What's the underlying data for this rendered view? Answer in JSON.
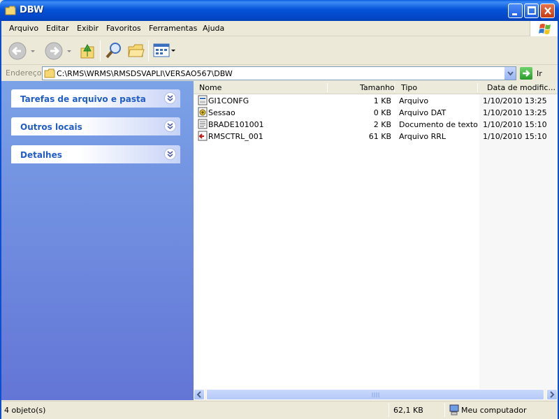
{
  "window": {
    "title": "DBW"
  },
  "menu": {
    "items": [
      {
        "first": "A",
        "rest": "rquivo"
      },
      {
        "first": "E",
        "rest": "ditar"
      },
      {
        "first": "E",
        "rest": "x",
        "tail": "ibir",
        "underline_index": 1
      },
      {
        "first": "F",
        "rest": "avoritos"
      },
      {
        "first": "F",
        "rest": "e",
        "tail": "rramentas",
        "underline_index": 1
      },
      {
        "first": "A",
        "rest": "j",
        "tail": "uda",
        "underline_index": 1
      }
    ],
    "labels": [
      "Arquivo",
      "Editar",
      "Exibir",
      "Favoritos",
      "Ferramentas",
      "Ajuda"
    ]
  },
  "address": {
    "label": "Endereço",
    "path": "C:\\RMS\\WRMS\\RMSDSVAPLI\\VERSAO567\\DBW",
    "go_label": "Ir"
  },
  "taskpane": {
    "sections": [
      {
        "title": "Tarefas de arquivo e pasta"
      },
      {
        "title": "Outros locais"
      },
      {
        "title": "Detalhes"
      }
    ]
  },
  "filelist": {
    "columns": [
      "Nome",
      "Tamanho",
      "Tipo",
      "Data de modific..."
    ],
    "rows": [
      {
        "name": "GI1CONFG",
        "size": "1 KB",
        "type": "Arquivo",
        "date": "1/10/2010 13:25",
        "icon": "generic-file-icon"
      },
      {
        "name": "Sessao",
        "size": "0 KB",
        "type": "Arquivo DAT",
        "date": "1/10/2010 13:25",
        "icon": "dat-file-icon"
      },
      {
        "name": "BRADE101001",
        "size": "2 KB",
        "type": "Documento de texto",
        "date": "1/10/2010 15:10",
        "icon": "text-file-icon"
      },
      {
        "name": "RMSCTRL_001",
        "size": "61 KB",
        "type": "Arquivo RRL",
        "date": "1/10/2010 15:10",
        "icon": "rrl-file-icon"
      }
    ]
  },
  "status": {
    "count": "4 objeto(s)",
    "size": "62,1 KB",
    "location": "Meu computador"
  },
  "colors": {
    "title_blue": "#0553d8",
    "task_link_blue": "#215dc6",
    "pane_top": "#7ba2e7",
    "pane_bottom": "#6375d6"
  }
}
